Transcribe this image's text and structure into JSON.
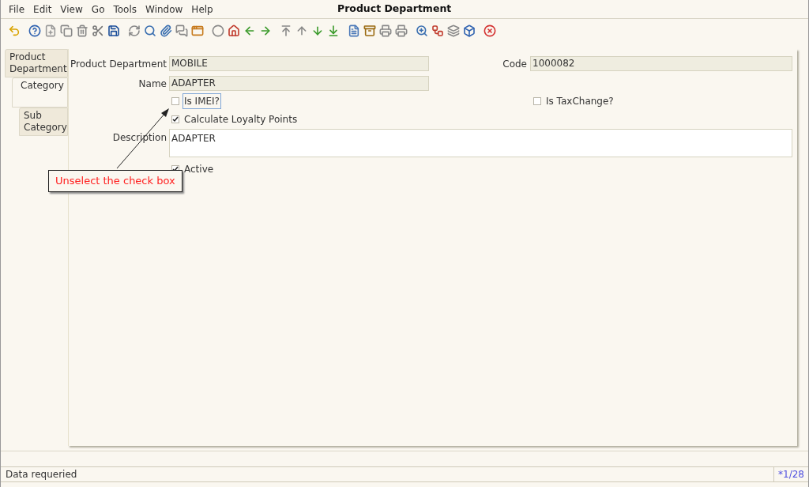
{
  "window": {
    "title": "Product Department"
  },
  "menu": [
    {
      "label": "File"
    },
    {
      "label": "Edit"
    },
    {
      "label": "View"
    },
    {
      "label": "Go"
    },
    {
      "label": "Tools"
    },
    {
      "label": "Window"
    },
    {
      "label": "Help"
    }
  ],
  "tabs": [
    {
      "label": "Product Department",
      "selected": false,
      "children": [
        {
          "label": "Category",
          "selected": true,
          "children": [
            {
              "label": "Sub Category",
              "selected": false
            }
          ]
        }
      ]
    }
  ],
  "fields": {
    "product_department": {
      "label": "Product Department",
      "value": "MOBILE"
    },
    "code": {
      "label": "Code",
      "value": "1000082"
    },
    "name": {
      "label": "Name",
      "value": "ADAPTER"
    },
    "description": {
      "label": "Description",
      "value": "ADAPTER"
    }
  },
  "checkboxes": [
    {
      "label": "Is IMEI?",
      "checked": false,
      "focused": true
    },
    {
      "label": "Is TaxChange?",
      "checked": false,
      "focused": false
    },
    {
      "label": "Calculate Loyalty Points",
      "checked": true,
      "focused": false
    },
    {
      "label": "Active",
      "checked": true,
      "focused": false
    }
  ],
  "callout": {
    "text": "Unselect the check box"
  },
  "status_bar": {
    "message": "Data requeried",
    "record": "*1/28"
  }
}
